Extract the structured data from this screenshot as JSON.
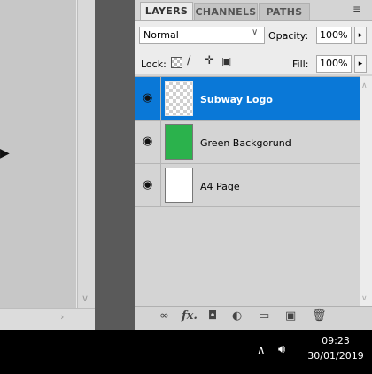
{
  "tabs": [
    {
      "label": "LAYERS",
      "active": true
    },
    {
      "label": "CHANNELS",
      "active": false
    },
    {
      "label": "PATHS",
      "active": false
    }
  ],
  "options": {
    "blend_mode": "Normal",
    "opacity_label": "Opacity:",
    "opacity_value": "100%",
    "lock_label": "Lock:",
    "fill_label": "Fill:",
    "fill_value": "100%"
  },
  "layers": [
    {
      "name": "Subway Logo",
      "selected": true,
      "visible": true,
      "thumbnail": "transparent"
    },
    {
      "name": "Green Backgorund",
      "selected": false,
      "visible": true,
      "thumbnail": "#2bb24c"
    },
    {
      "name": "A4 Page",
      "selected": false,
      "visible": true,
      "thumbnail": "#ffffff"
    }
  ],
  "bottom_toolbar": {
    "icons": [
      "link-icon",
      "fx-icon",
      "mask-icon",
      "adjustment-icon",
      "folder-icon",
      "new-layer-icon",
      "trash-icon"
    ],
    "fx_label": "fx."
  },
  "taskbar": {
    "time": "09:23",
    "date": "30/01/2019"
  },
  "colors": {
    "selection": "#0a78d7",
    "panel": "#d4d4d4",
    "taskbar": "#000000"
  }
}
